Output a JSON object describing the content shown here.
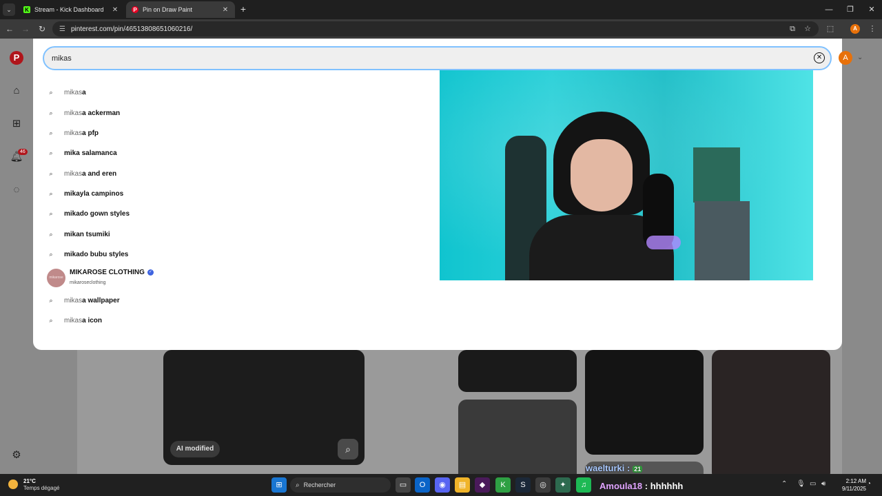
{
  "browser": {
    "tabs": [
      {
        "label": "Stream - Kick Dashboard",
        "active": false,
        "favicon": "K"
      },
      {
        "label": "Pin on Draw Paint",
        "active": true,
        "favicon": "P"
      }
    ],
    "url": "pinterest.com/pin/465138086510602​16/",
    "colors": {
      "accent": "#3a3a3a",
      "tabbar": "#1f1f1f"
    }
  },
  "sidebar": {
    "notifications_count": "46"
  },
  "search": {
    "value": "mikas"
  },
  "user": {
    "initial": "A"
  },
  "suggestions": [
    {
      "pre": "mikas",
      "post": "a"
    },
    {
      "pre": "mikas",
      "post": "a ackerman"
    },
    {
      "pre": "mikas",
      "post": "a pfp"
    },
    {
      "pre": "",
      "post": "mika salamanca"
    },
    {
      "pre": "mikas",
      "post": "a and eren"
    },
    {
      "pre": "",
      "post": "mikayla campinos"
    },
    {
      "pre": "",
      "post": "mikado gown styles"
    },
    {
      "pre": "",
      "post": "mikan tsumiki"
    },
    {
      "pre": "",
      "post": "mikado bubu styles"
    }
  ],
  "account_suggestion": {
    "name": "MIKAROSE CLOTHING",
    "handle": "mikaroseclothing",
    "avatar_text": "mikarose"
  },
  "suggestions_after": [
    {
      "pre": "mikas",
      "post": "a wallpaper"
    },
    {
      "pre": "mikas",
      "post": "a icon"
    }
  ],
  "background": {
    "ai_badge": "AI modified"
  },
  "chat": {
    "user1": "waelturki :",
    "badge1": "21",
    "user2": "Amoula18",
    "msg2": ": hhhhhh"
  },
  "taskbar": {
    "weather_temp": "21°C",
    "weather_desc": "Temps dégagé",
    "search_label": "Rechercher",
    "time": "2:12 AM",
    "date": "9/11/2025"
  }
}
